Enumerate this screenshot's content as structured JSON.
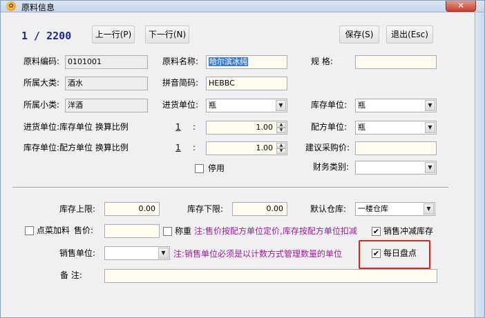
{
  "window": {
    "title": "原料信息",
    "close_glyph": "✕"
  },
  "nav": {
    "counter": "1 / 2200",
    "prev_label": "上一行(P)",
    "next_label": "下一行(N)",
    "save_label": "保存(S)",
    "exit_label": "退出(Esc)"
  },
  "fields": {
    "code_label": "原料编码:",
    "code_value": "0101001",
    "name_label": "原料名称:",
    "name_value": "哈尔滨冰纯",
    "spec_label": "规    格:",
    "spec_value": "",
    "category_label": "所属大类:",
    "category_value": "酒水",
    "pinyin_label": "拼音简码:",
    "pinyin_value": "HEBBC",
    "subcategory_label": "所属小类:",
    "subcategory_value": "洋酒",
    "purchase_unit_label": "进货单位:",
    "purchase_unit_value": "瓶",
    "stock_unit_label": "库存单位:",
    "stock_unit_value": "瓶",
    "ratio1_label": "进货单位:库存单位 换算比例",
    "ratio1_left": "1",
    "ratio1_right": "1.00",
    "recipe_unit_label": "配方单位:",
    "recipe_unit_value": "瓶",
    "ratio2_label": "库存单位:配方单位 换算比例",
    "ratio2_left": "1",
    "ratio2_right": "1.00",
    "suggest_price_label": "建议采购价:",
    "suggest_price_value": "",
    "disable_label": "停用",
    "finance_label": "财务类别:",
    "finance_value": "",
    "colon": ":"
  },
  "lower": {
    "stock_upper_label": "库存上限:",
    "stock_upper_value": "0.00",
    "stock_lower_label": "库存下限:",
    "stock_lower_value": "0.00",
    "default_wh_label": "默认仓库:",
    "default_wh_value": "一楼仓库",
    "addon_label": "点菜加料",
    "price_label": "售价:",
    "price_value": "",
    "weigh_label": "称重",
    "note1": "注:售价按配方单位定价,库存按配方单位扣减",
    "sale_deduct_label": "销售冲减库存",
    "sale_unit_label": "销售单位:",
    "sale_unit_value": "",
    "note2": "注:销售单位必须是以计数方式管理数量的单位",
    "daily_count_label": "每日盘点",
    "remark_label": "备    注:",
    "remark_value": ""
  },
  "colors": {
    "highlight": "#e0221b",
    "note": "#a0199b",
    "counter": "#1a2a8a"
  }
}
